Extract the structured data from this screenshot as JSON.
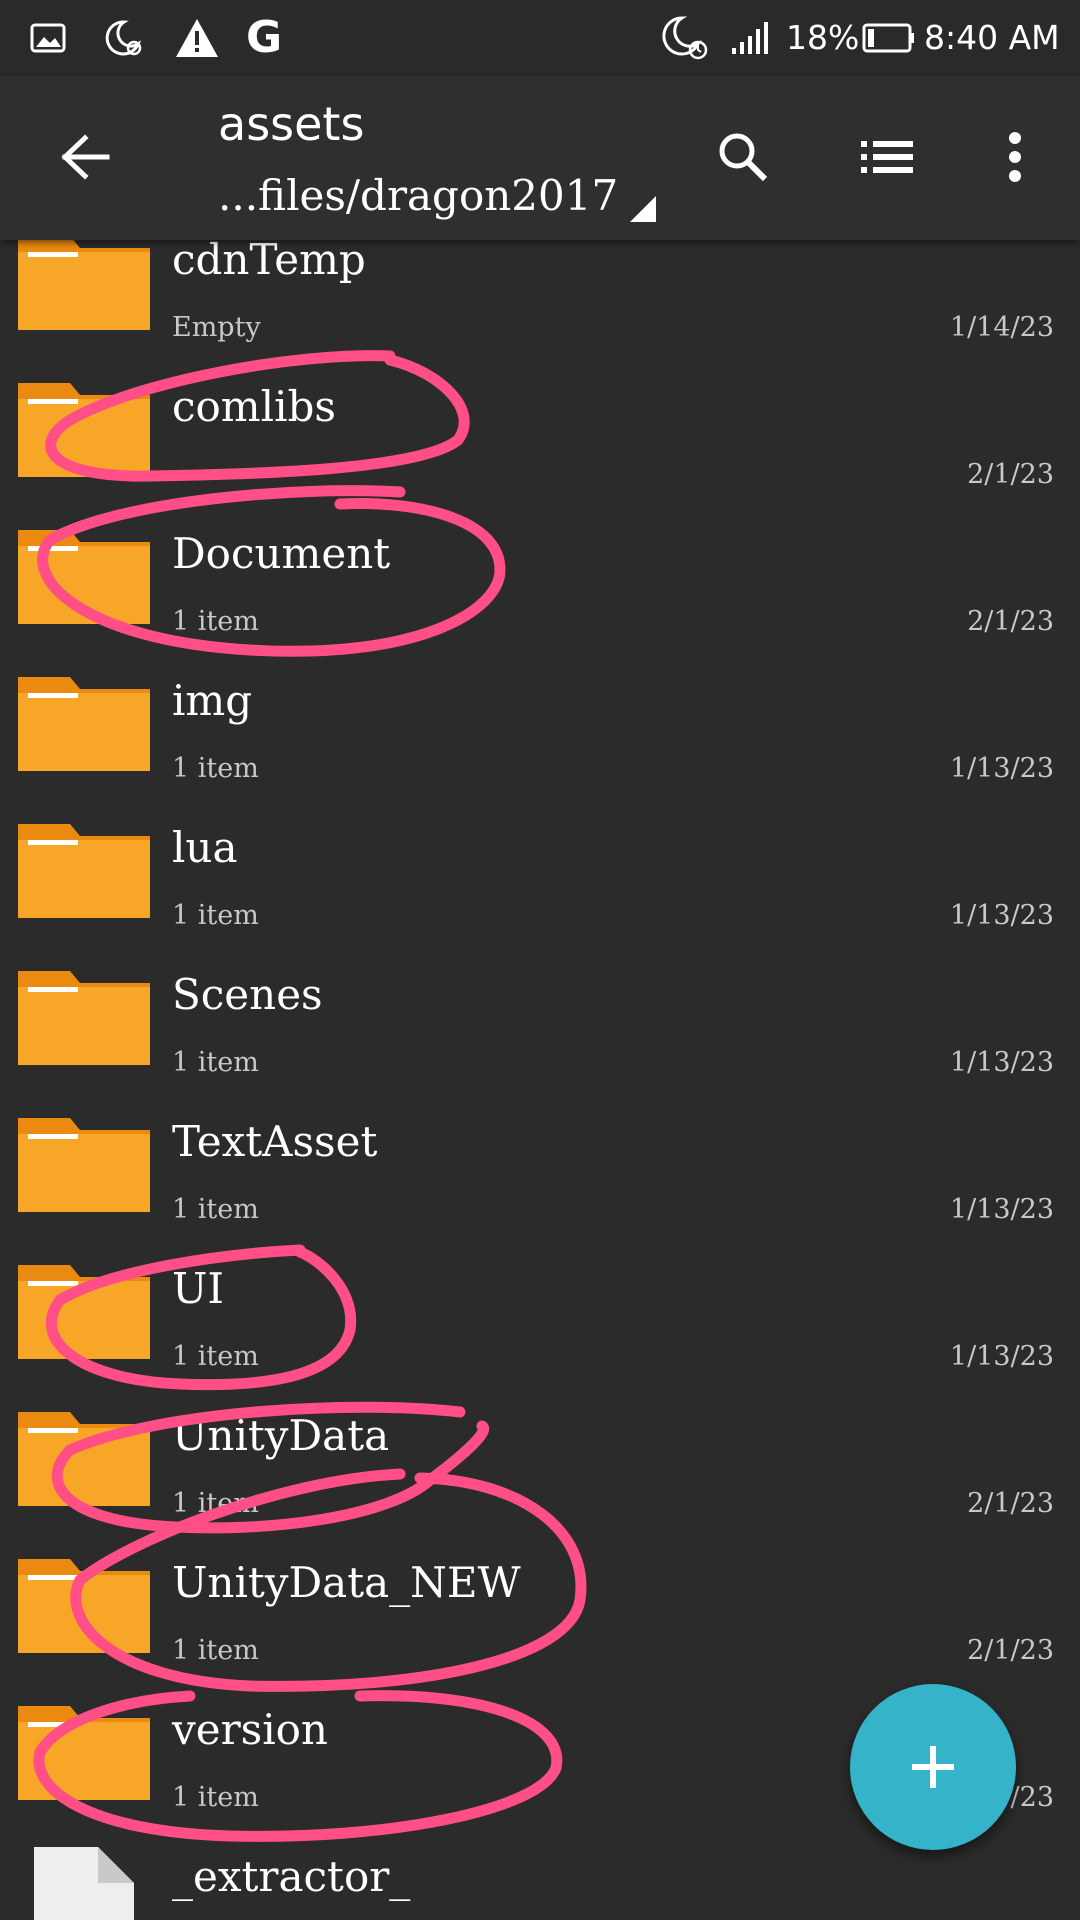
{
  "status_bar": {
    "battery_percent": "18%",
    "time": "8:40 AM",
    "icons": [
      "gallery-icon",
      "do-not-disturb-icon",
      "warning-icon",
      "google-icon",
      "alarm-icon",
      "signal-icon",
      "battery-icon"
    ],
    "google_letter": "G"
  },
  "toolbar": {
    "title": "assets",
    "path": "...files/dragon2017",
    "icons": [
      "back-arrow-icon",
      "search-icon",
      "list-view-icon",
      "more-vert-icon"
    ]
  },
  "files": [
    {
      "name": "cdnTemp",
      "sub": "Empty",
      "date": "1/14/23",
      "type": "folder"
    },
    {
      "name": "comlibs",
      "sub": "",
      "date": "2/1/23",
      "type": "folder"
    },
    {
      "name": "Document",
      "sub": "1 item",
      "date": "2/1/23",
      "type": "folder"
    },
    {
      "name": "img",
      "sub": "1 item",
      "date": "1/13/23",
      "type": "folder"
    },
    {
      "name": "lua",
      "sub": "1 item",
      "date": "1/13/23",
      "type": "folder"
    },
    {
      "name": "Scenes",
      "sub": "1 item",
      "date": "1/13/23",
      "type": "folder"
    },
    {
      "name": "TextAsset",
      "sub": "1 item",
      "date": "1/13/23",
      "type": "folder"
    },
    {
      "name": "UI",
      "sub": "1 item",
      "date": "1/13/23",
      "type": "folder"
    },
    {
      "name": "UnityData",
      "sub": "1 item",
      "date": "2/1/23",
      "type": "folder"
    },
    {
      "name": "UnityData_NEW",
      "sub": "1 item",
      "date": "2/1/23",
      "type": "folder"
    },
    {
      "name": "version",
      "sub": "1 item",
      "date": "1/23",
      "type": "folder"
    },
    {
      "name": "_extractor_",
      "sub": "",
      "date": "",
      "type": "file"
    }
  ],
  "fab": {
    "icon": "plus-icon",
    "color": "#35b3c9"
  },
  "colors": {
    "background": "#2b2b2b",
    "folder": "#f7a627",
    "folder_tab": "#ea8a10",
    "annotation": "#ff4f86"
  }
}
